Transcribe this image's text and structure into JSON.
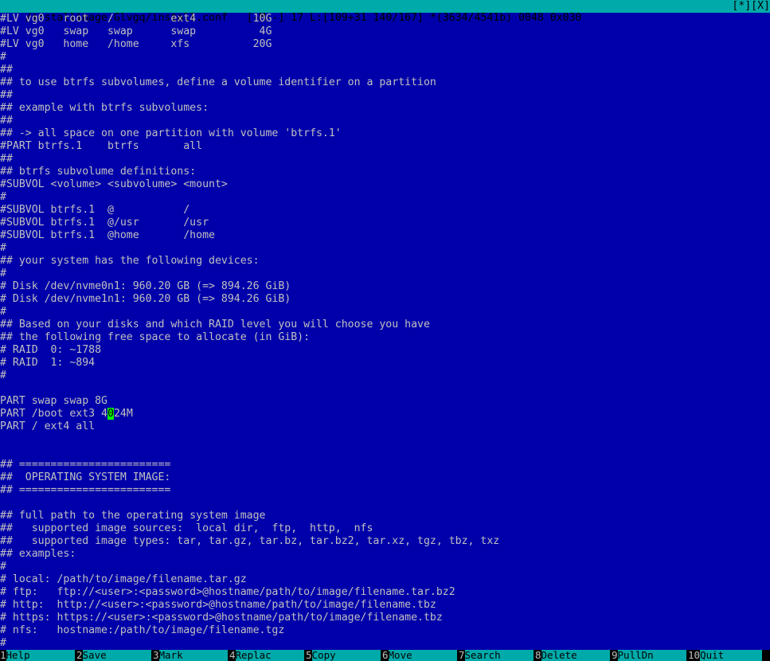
{
  "status_bar": {
    "filename": "/installimage.Glvgq/install.conf",
    "info": "[-M--] 17 L:[109+31 140/167] *(3634/4541b) 0048 0x030",
    "window_controls": "[*][X]"
  },
  "colors": {
    "background": "#0000aa",
    "text": "#c0c0c0",
    "status_bar": "#00aaaa",
    "cursor": "#00ff00"
  },
  "editor": {
    "lines": [
      "#LV vg0   root   /         ext4         10G",
      "#LV vg0   swap   swap      swap          4G",
      "#LV vg0   home   /home     xfs          20G",
      "#",
      "##",
      "## to use btrfs subvolumes, define a volume identifier on a partition",
      "##",
      "## example with btrfs subvolumes:",
      "##",
      "## -> all space on one partition with volume 'btrfs.1'",
      "#PART btrfs.1    btrfs       all",
      "##",
      "## btrfs subvolume definitions:",
      "#SUBVOL <volume> <subvolume> <mount>",
      "#",
      "#SUBVOL btrfs.1  @           /",
      "#SUBVOL btrfs.1  @/usr       /usr",
      "#SUBVOL btrfs.1  @home       /home",
      "#",
      "## your system has the following devices:",
      "#",
      "# Disk /dev/nvme0n1: 960.20 GB (=> 894.26 GiB)",
      "# Disk /dev/nvme1n1: 960.20 GB (=> 894.26 GiB)",
      "#",
      "## Based on your disks and which RAID level you will choose you have",
      "## the following free space to allocate (in GiB):",
      "# RAID  0: ~1788",
      "# RAID  1: ~894",
      "#",
      "",
      "PART swap swap 8G",
      "__CURSOR__",
      "PART / ext4 all",
      "",
      "",
      "## ========================",
      "##  OPERATING SYSTEM IMAGE:",
      "## ========================",
      "",
      "## full path to the operating system image",
      "##   supported image sources:  local dir,  ftp,  http,  nfs",
      "##   supported image types: tar, tar.gz, tar.bz, tar.bz2, tar.xz, tgz, tbz, txz",
      "## examples:",
      "#",
      "# local: /path/to/image/filename.tar.gz",
      "# ftp:   ftp://<user>:<password>@hostname/path/to/image/filename.tar.bz2",
      "# http:  http://<user>:<password>@hostname/path/to/image/filename.tbz",
      "# https: https://<user>:<password>@hostname/path/to/image/filename.tbz",
      "# nfs:   hostname:/path/to/image/filename.tgz",
      "#"
    ],
    "cursor_line": {
      "before": "PART /boot ext3 4",
      "cursor_char": "0",
      "after": "24M"
    }
  },
  "function_keys": [
    {
      "num": "1",
      "label": "Help"
    },
    {
      "num": "2",
      "label": "Save"
    },
    {
      "num": "3",
      "label": "Mark"
    },
    {
      "num": "4",
      "label": "Replac"
    },
    {
      "num": "5",
      "label": "Copy"
    },
    {
      "num": "6",
      "label": "Move"
    },
    {
      "num": "7",
      "label": "Search"
    },
    {
      "num": "8",
      "label": "Delete"
    },
    {
      "num": "9",
      "label": "PullDn"
    },
    {
      "num": "10",
      "label": "Quit"
    }
  ]
}
